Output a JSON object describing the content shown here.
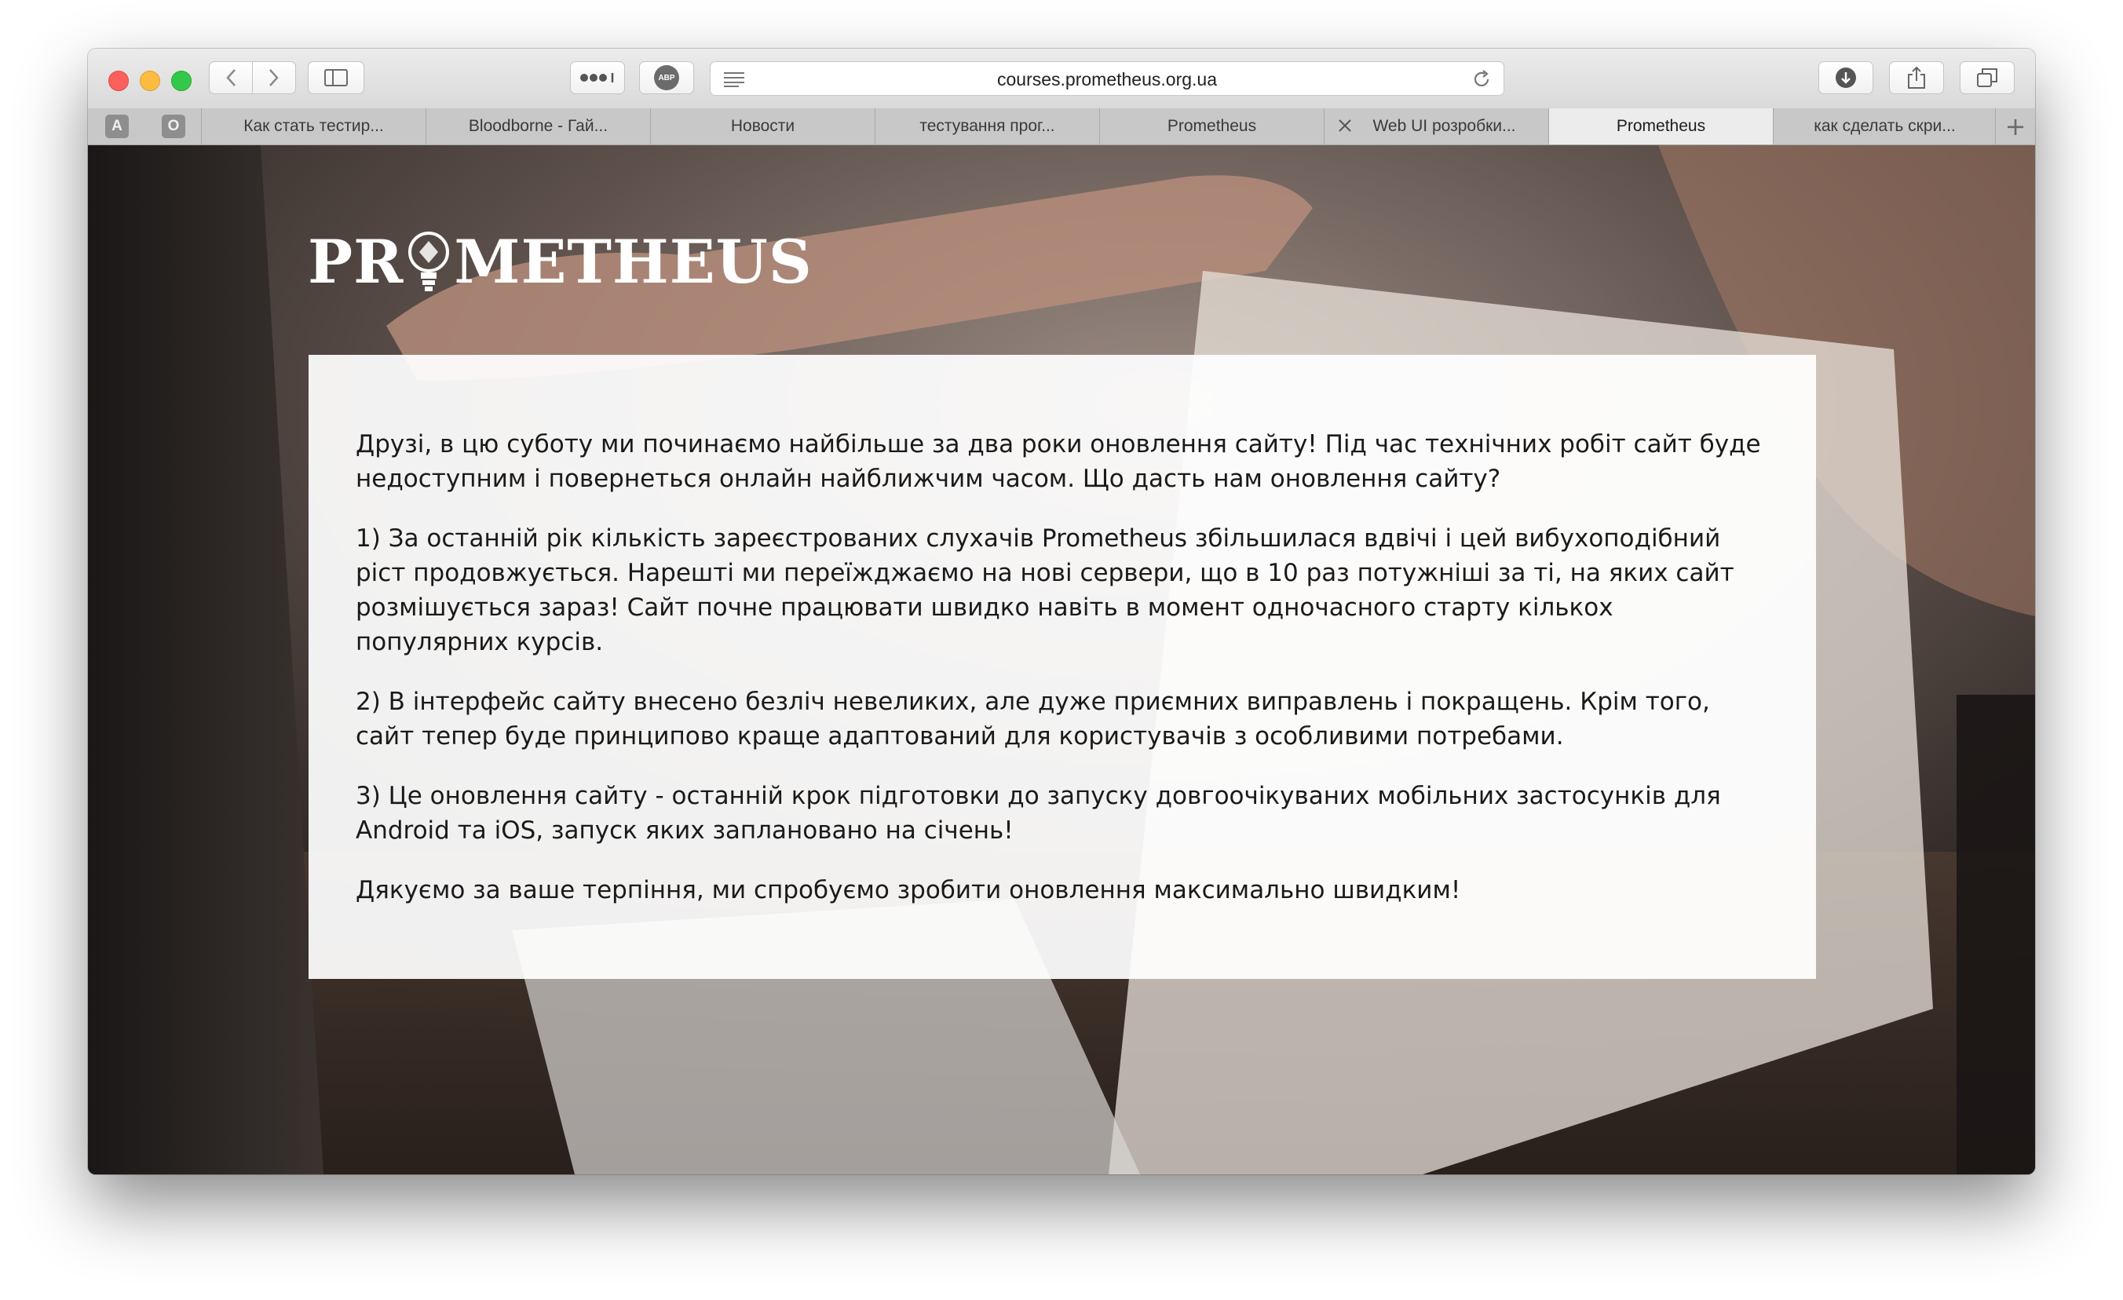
{
  "browser": {
    "url": "courses.prometheus.org.ua",
    "toolbar_icons": [
      "back-icon",
      "forward-icon",
      "sidebar-icon",
      "more-dots-icon",
      "adblock-icon",
      "reader-icon",
      "reload-icon",
      "download-icon",
      "share-icon",
      "tabs-overview-icon"
    ],
    "adblock_label": "ABP",
    "pinned_tabs": [
      {
        "label": "A"
      },
      {
        "label": "O"
      }
    ],
    "tabs": [
      {
        "title": "Как стать тестир..."
      },
      {
        "title": "Bloodborne - Гай..."
      },
      {
        "title": "Новости"
      },
      {
        "title": "тестування прог..."
      },
      {
        "title": "Prometheus"
      },
      {
        "title": "Web UI розробки..."
      },
      {
        "title": "Prometheus"
      },
      {
        "title": "как сделать скри..."
      }
    ],
    "active_tab_index": 6,
    "new_tab_symbol": "+"
  },
  "page": {
    "logo": {
      "left_text": "PR",
      "right_text": "METHEUS"
    },
    "paragraphs": [
      "Друзі, в цю суботу ми починаємо найбільше за два роки оновлення сайту! Під час технічних робіт сайт буде недоступним і повернеться онлайн найближчим часом. Що дасть нам оновлення сайту?",
      "1) За останній рік кількість зареєстрованих слухачів Prometheus збільшилася вдвічі і цей вибухоподібний ріст продовжується. Нарешті ми переїжджаємо на нові сервери, що в 10 раз потужніші за ті, на яких сайт розмішується зараз! Сайт почне працювати швидко навіть в момент одночасного старту кількох популярних курсів.",
      "2) В інтерфейс сайту внесено безліч невеликих, але дуже приємних виправлень і покращень. Крім того, сайт тепер буде принципово краще адаптований для користувачів з особливими потребами.",
      "3) Це оновлення сайту - останній крок підготовки до запуску довгоочікуваних мобільних застосунків для Android та iOS, запуск яких заплановано на січень!",
      "Дякуємо за ваше терпіння, ми спробуємо зробити оновлення максимально швидким!"
    ]
  },
  "colors": {
    "close": "#fc605c",
    "minimize": "#fdbc40",
    "zoom": "#34c84a",
    "card_background": "#ffffff",
    "page_background": "#2b2624"
  }
}
